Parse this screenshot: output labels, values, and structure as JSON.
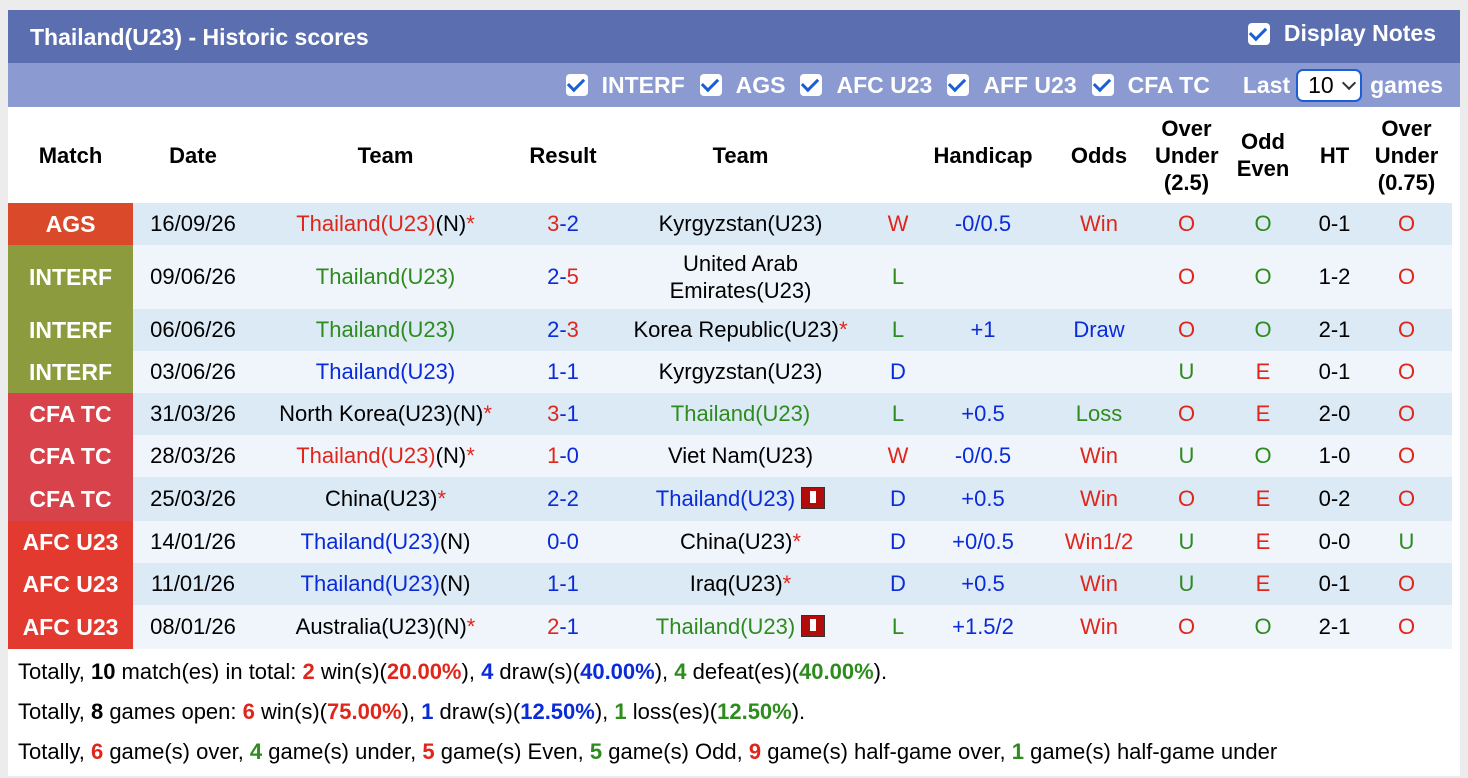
{
  "title": "Thailand(U23) - Historic scores",
  "display_notes": "Display Notes",
  "filters": [
    "INTERF",
    "AGS",
    "AFC U23",
    "AFF U23",
    "CFA TC"
  ],
  "last_label": "Last",
  "last_value": "10",
  "games_label": "games",
  "headers": {
    "match": "Match",
    "date": "Date",
    "team1": "Team",
    "result": "Result",
    "team2": "Team",
    "handicap": "Handicap",
    "odds": "Odds",
    "ou25": [
      "Over",
      "Under",
      "(2.5)"
    ],
    "oe": [
      "Odd",
      "Even"
    ],
    "ht": "HT",
    "ou075": [
      "Over",
      "Under",
      "(0.75)"
    ]
  },
  "league_colors": {
    "AGS": "#d9492a",
    "INTERF": "#8c9b3d",
    "CFA TC": "#d8424a",
    "AFC U23": "#e33a30"
  },
  "rows": [
    {
      "league": "AGS",
      "date": "16/09/26",
      "t1": "Thailand(U23)",
      "t1c": "red",
      "t1n": "(N)",
      "t1s": "*",
      "t1rc": false,
      "g1": "3",
      "g1c": "red",
      "g2": "2",
      "g2c": "blue",
      "t2": "Kyrgyzstan(U23)",
      "t2c": "black",
      "t2n": "",
      "t2s": "",
      "t2rc": false,
      "wl": "W",
      "wlc": "red",
      "hc": "-0/0.5",
      "odds": "Win",
      "oddsc": "red",
      "ou": "O",
      "ouc": "red",
      "oe": "O",
      "oec": "green",
      "ht": "0-1",
      "ou2": "O",
      "ou2c": "red"
    },
    {
      "league": "INTERF",
      "date": "09/06/26",
      "t1": "Thailand(U23)",
      "t1c": "green",
      "t1n": "",
      "t1s": "",
      "t1rc": false,
      "g1": "2",
      "g1c": "blue",
      "g2": "5",
      "g2c": "red",
      "t2": "United Arab Emirates(U23)",
      "t2c": "black",
      "t2n": "",
      "t2s": "",
      "t2rc": false,
      "wl": "L",
      "wlc": "green",
      "hc": "",
      "odds": "",
      "oddsc": "black",
      "ou": "O",
      "ouc": "red",
      "oe": "O",
      "oec": "green",
      "ht": "1-2",
      "ou2": "O",
      "ou2c": "red"
    },
    {
      "league": "INTERF",
      "date": "06/06/26",
      "t1": "Thailand(U23)",
      "t1c": "green",
      "t1n": "",
      "t1s": "",
      "t1rc": false,
      "g1": "2",
      "g1c": "blue",
      "g2": "3",
      "g2c": "red",
      "t2": "Korea Republic(U23)",
      "t2c": "black",
      "t2n": "",
      "t2s": "*",
      "t2rc": false,
      "wl": "L",
      "wlc": "green",
      "hc": "+1",
      "odds": "Draw",
      "oddsc": "blue",
      "ou": "O",
      "ouc": "red",
      "oe": "O",
      "oec": "green",
      "ht": "2-1",
      "ou2": "O",
      "ou2c": "red"
    },
    {
      "league": "INTERF",
      "date": "03/06/26",
      "t1": "Thailand(U23)",
      "t1c": "blue",
      "t1n": "",
      "t1s": "",
      "t1rc": false,
      "g1": "1",
      "g1c": "blue",
      "g2": "1",
      "g2c": "blue",
      "t2": "Kyrgyzstan(U23)",
      "t2c": "black",
      "t2n": "",
      "t2s": "",
      "t2rc": false,
      "wl": "D",
      "wlc": "blue",
      "hc": "",
      "odds": "",
      "oddsc": "black",
      "ou": "U",
      "ouc": "green",
      "oe": "E",
      "oec": "red",
      "ht": "0-1",
      "ou2": "O",
      "ou2c": "red"
    },
    {
      "league": "CFA TC",
      "date": "31/03/26",
      "t1": "North Korea(U23)",
      "t1c": "black",
      "t1n": "(N)",
      "t1s": "*",
      "t1rc": false,
      "g1": "3",
      "g1c": "red",
      "g2": "1",
      "g2c": "blue",
      "t2": "Thailand(U23)",
      "t2c": "green",
      "t2n": "",
      "t2s": "",
      "t2rc": false,
      "wl": "L",
      "wlc": "green",
      "hc": "+0.5",
      "odds": "Loss",
      "oddsc": "green",
      "ou": "O",
      "ouc": "red",
      "oe": "E",
      "oec": "red",
      "ht": "2-0",
      "ou2": "O",
      "ou2c": "red"
    },
    {
      "league": "CFA TC",
      "date": "28/03/26",
      "t1": "Thailand(U23)",
      "t1c": "red",
      "t1n": "(N)",
      "t1s": "*",
      "t1rc": false,
      "g1": "1",
      "g1c": "red",
      "g2": "0",
      "g2c": "blue",
      "t2": "Viet Nam(U23)",
      "t2c": "black",
      "t2n": "",
      "t2s": "",
      "t2rc": false,
      "wl": "W",
      "wlc": "red",
      "hc": "-0/0.5",
      "odds": "Win",
      "oddsc": "red",
      "ou": "U",
      "ouc": "green",
      "oe": "O",
      "oec": "green",
      "ht": "1-0",
      "ou2": "O",
      "ou2c": "red"
    },
    {
      "league": "CFA TC",
      "date": "25/03/26",
      "t1": "China(U23)",
      "t1c": "black",
      "t1n": "",
      "t1s": "*",
      "t1rc": false,
      "g1": "2",
      "g1c": "blue",
      "g2": "2",
      "g2c": "blue",
      "t2": "Thailand(U23)",
      "t2c": "blue",
      "t2n": "",
      "t2s": "",
      "t2rc": true,
      "wl": "D",
      "wlc": "blue",
      "hc": "+0.5",
      "odds": "Win",
      "oddsc": "red",
      "ou": "O",
      "ouc": "red",
      "oe": "E",
      "oec": "red",
      "ht": "0-2",
      "ou2": "O",
      "ou2c": "red"
    },
    {
      "league": "AFC U23",
      "date": "14/01/26",
      "t1": "Thailand(U23)",
      "t1c": "blue",
      "t1n": "(N)",
      "t1s": "",
      "t1rc": false,
      "g1": "0",
      "g1c": "blue",
      "g2": "0",
      "g2c": "blue",
      "t2": "China(U23)",
      "t2c": "black",
      "t2n": "",
      "t2s": "*",
      "t2rc": false,
      "wl": "D",
      "wlc": "blue",
      "hc": "+0/0.5",
      "odds": "Win1/2",
      "oddsc": "red",
      "ou": "U",
      "ouc": "green",
      "oe": "E",
      "oec": "red",
      "ht": "0-0",
      "ou2": "U",
      "ou2c": "green"
    },
    {
      "league": "AFC U23",
      "date": "11/01/26",
      "t1": "Thailand(U23)",
      "t1c": "blue",
      "t1n": "(N)",
      "t1s": "",
      "t1rc": false,
      "g1": "1",
      "g1c": "blue",
      "g2": "1",
      "g2c": "blue",
      "t2": "Iraq(U23)",
      "t2c": "black",
      "t2n": "",
      "t2s": "*",
      "t2rc": false,
      "wl": "D",
      "wlc": "blue",
      "hc": "+0.5",
      "odds": "Win",
      "oddsc": "red",
      "ou": "U",
      "ouc": "green",
      "oe": "E",
      "oec": "red",
      "ht": "0-1",
      "ou2": "O",
      "ou2c": "red"
    },
    {
      "league": "AFC U23",
      "date": "08/01/26",
      "t1": "Australia(U23)",
      "t1c": "black",
      "t1n": "(N)",
      "t1s": "*",
      "t1rc": false,
      "g1": "2",
      "g1c": "red",
      "g2": "1",
      "g2c": "blue",
      "t2": "Thailand(U23)",
      "t2c": "green",
      "t2n": "",
      "t2s": "",
      "t2rc": true,
      "wl": "L",
      "wlc": "green",
      "hc": "+1.5/2",
      "odds": "Win",
      "oddsc": "red",
      "ou": "O",
      "ouc": "red",
      "oe": "O",
      "oec": "green",
      "ht": "2-1",
      "ou2": "O",
      "ou2c": "red"
    }
  ],
  "totals": {
    "line1": [
      {
        "t": "Totally, ",
        "c": ""
      },
      {
        "t": "10",
        "c": "b"
      },
      {
        "t": " match(es) in total: ",
        "c": ""
      },
      {
        "t": "2",
        "c": "tr"
      },
      {
        "t": " win(s)(",
        "c": ""
      },
      {
        "t": "20.00%",
        "c": "tr"
      },
      {
        "t": "), ",
        "c": ""
      },
      {
        "t": "4",
        "c": "tb"
      },
      {
        "t": " draw(s)(",
        "c": ""
      },
      {
        "t": "40.00%",
        "c": "tb"
      },
      {
        "t": "), ",
        "c": ""
      },
      {
        "t": "4",
        "c": "tg"
      },
      {
        "t": " defeat(es)(",
        "c": ""
      },
      {
        "t": "40.00%",
        "c": "tg"
      },
      {
        "t": ").",
        "c": ""
      }
    ],
    "line2": [
      {
        "t": "Totally, ",
        "c": ""
      },
      {
        "t": "8",
        "c": "b"
      },
      {
        "t": " games open: ",
        "c": ""
      },
      {
        "t": "6",
        "c": "tr"
      },
      {
        "t": " win(s)(",
        "c": ""
      },
      {
        "t": "75.00%",
        "c": "tr"
      },
      {
        "t": "), ",
        "c": ""
      },
      {
        "t": "1",
        "c": "tb"
      },
      {
        "t": " draw(s)(",
        "c": ""
      },
      {
        "t": "12.50%",
        "c": "tb"
      },
      {
        "t": "), ",
        "c": ""
      },
      {
        "t": "1",
        "c": "tg"
      },
      {
        "t": " loss(es)(",
        "c": ""
      },
      {
        "t": "12.50%",
        "c": "tg"
      },
      {
        "t": ").",
        "c": ""
      }
    ],
    "line3": [
      {
        "t": "Totally, ",
        "c": ""
      },
      {
        "t": "6",
        "c": "tr"
      },
      {
        "t": " game(s) over, ",
        "c": ""
      },
      {
        "t": "4",
        "c": "tg"
      },
      {
        "t": " game(s) under, ",
        "c": ""
      },
      {
        "t": "5",
        "c": "tr"
      },
      {
        "t": " game(s) Even, ",
        "c": ""
      },
      {
        "t": "5",
        "c": "tg"
      },
      {
        "t": " game(s) Odd, ",
        "c": ""
      },
      {
        "t": "9",
        "c": "tr"
      },
      {
        "t": " game(s) half-game over, ",
        "c": ""
      },
      {
        "t": "1",
        "c": "tg"
      },
      {
        "t": " game(s) half-game under",
        "c": ""
      }
    ]
  }
}
